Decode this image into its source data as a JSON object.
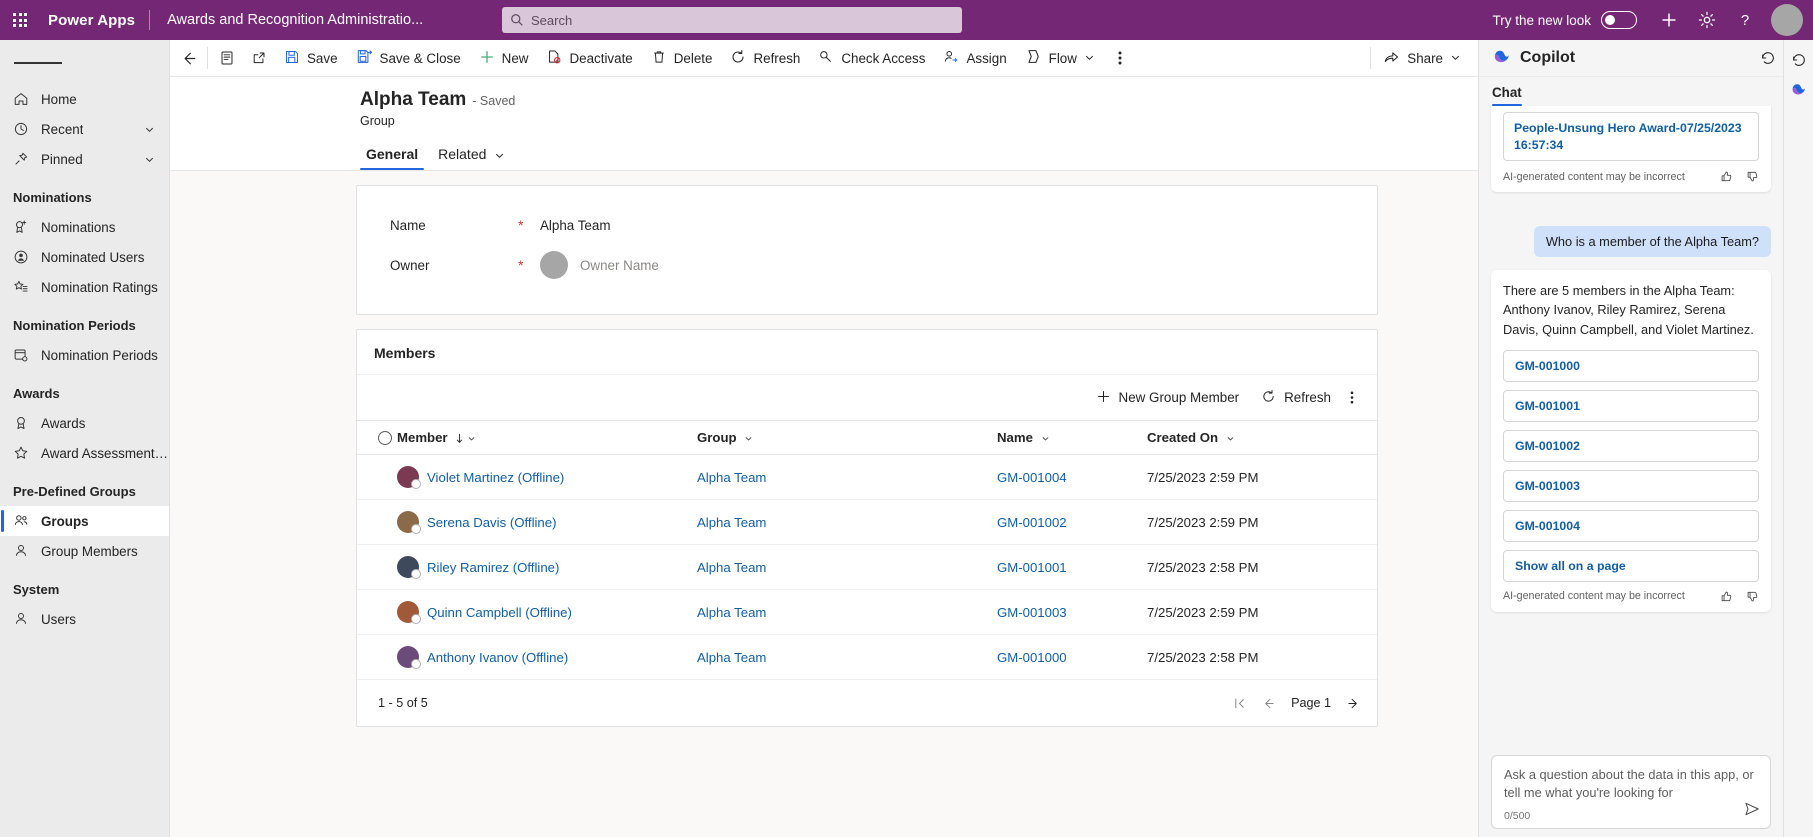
{
  "header": {
    "waffle_label": "app-launcher",
    "brand": "Power Apps",
    "app_name": "Awards and Recognition Administratio...",
    "search_placeholder": "Search",
    "search_value": "",
    "try_new_look": "Try the new look",
    "plus_label": "New",
    "gear_label": "Settings",
    "help_label": "Help",
    "brand_color": "#742774"
  },
  "sidebar": {
    "items": [
      {
        "label": "Home",
        "icon": "home-icon",
        "chevron": false,
        "selected": false
      },
      {
        "label": "Recent",
        "icon": "clock-icon",
        "chevron": true,
        "selected": false
      },
      {
        "label": "Pinned",
        "icon": "pin-icon",
        "chevron": true,
        "selected": false
      }
    ],
    "groups": [
      {
        "title": "Nominations",
        "items": [
          {
            "label": "Nominations",
            "icon": "ribbon-plus-icon",
            "selected": false
          },
          {
            "label": "Nominated Users",
            "icon": "user-badge-icon",
            "selected": false
          },
          {
            "label": "Nomination Ratings",
            "icon": "star-list-icon",
            "selected": false
          }
        ]
      },
      {
        "title": "Nomination Periods",
        "items": [
          {
            "label": "Nomination Periods",
            "icon": "calendar-gear-icon",
            "selected": false
          }
        ]
      },
      {
        "title": "Awards",
        "items": [
          {
            "label": "Awards",
            "icon": "award-icon",
            "selected": false
          },
          {
            "label": "Award Assessment R...",
            "icon": "star-icon",
            "selected": false
          }
        ]
      },
      {
        "title": "Pre-Defined Groups",
        "items": [
          {
            "label": "Groups",
            "icon": "people-icon",
            "selected": true
          },
          {
            "label": "Group Members",
            "icon": "person-icon",
            "selected": false
          }
        ]
      },
      {
        "title": "System",
        "items": [
          {
            "label": "Users",
            "icon": "person-icon",
            "selected": false
          }
        ]
      }
    ]
  },
  "commandbar": {
    "back_label": "Back",
    "form_label": "Form selector",
    "popout_label": "Open in new window",
    "commands": [
      {
        "label": "Save",
        "icon": "save-icon"
      },
      {
        "label": "Save & Close",
        "icon": "save-close-icon"
      },
      {
        "label": "New",
        "icon": "plus-icon"
      },
      {
        "label": "Deactivate",
        "icon": "deactivate-icon"
      },
      {
        "label": "Delete",
        "icon": "trash-icon"
      },
      {
        "label": "Refresh",
        "icon": "refresh-icon"
      },
      {
        "label": "Check Access",
        "icon": "key-icon"
      },
      {
        "label": "Assign",
        "icon": "assign-icon"
      },
      {
        "label": "Flow",
        "icon": "flow-icon",
        "chevron": true
      }
    ],
    "overflow_label": "More commands",
    "share_label": "Share"
  },
  "record": {
    "title": "Alpha Team",
    "saved_state": "- Saved",
    "entity": "Group",
    "tabs": [
      {
        "label": "General",
        "active": true,
        "chevron": false
      },
      {
        "label": "Related",
        "active": false,
        "chevron": true
      }
    ]
  },
  "form": {
    "fields": [
      {
        "label": "Name",
        "required": "*",
        "value": "Alpha Team",
        "type": "text"
      },
      {
        "label": "Owner",
        "required": "*",
        "value": "Owner Name",
        "type": "lookup-avatar"
      }
    ]
  },
  "members": {
    "section_title": "Members",
    "toolbar": [
      {
        "label": "New Group Member",
        "icon": "plus-icon"
      },
      {
        "label": "Refresh",
        "icon": "refresh-icon"
      }
    ],
    "overflow_label": "More",
    "columns": [
      {
        "label": "Member",
        "sorted": true,
        "chevron": true
      },
      {
        "label": "Group",
        "sorted": false,
        "chevron": true
      },
      {
        "label": "Name",
        "sorted": false,
        "chevron": true
      },
      {
        "label": "Created On",
        "sorted": false,
        "chevron": true
      }
    ],
    "rows": [
      {
        "member": "Violet Martinez (Offline)",
        "group": "Alpha Team",
        "name": "GM-001004",
        "created_on": "7/25/2023 2:59 PM",
        "avatar_color": "#7a3b52"
      },
      {
        "member": "Serena Davis (Offline)",
        "group": "Alpha Team",
        "name": "GM-001002",
        "created_on": "7/25/2023 2:59 PM",
        "avatar_color": "#8a6a48"
      },
      {
        "member": "Riley Ramirez (Offline)",
        "group": "Alpha Team",
        "name": "GM-001001",
        "created_on": "7/25/2023 2:58 PM",
        "avatar_color": "#3e4a5c"
      },
      {
        "member": "Quinn Campbell (Offline)",
        "group": "Alpha Team",
        "name": "GM-001003",
        "created_on": "7/25/2023 2:59 PM",
        "avatar_color": "#a05a3a"
      },
      {
        "member": "Anthony Ivanov (Offline)",
        "group": "Alpha Team",
        "name": "GM-001000",
        "created_on": "7/25/2023 2:58 PM",
        "avatar_color": "#6b4b7a"
      }
    ],
    "footer_count": "1 - 5 of 5",
    "page_label": "Page 1"
  },
  "copilot": {
    "title": "Copilot",
    "history_label": "Chat history",
    "expand_label": "Expand",
    "tab": "Chat",
    "prev_answer": {
      "chip": "People-Unsung Hero Award-07/25/2023 16:57:34",
      "disclaimer": "AI-generated content may be incorrect"
    },
    "user_message": "Who is a member of the Alpha Team?",
    "answer": {
      "text": "There are 5 members in the Alpha Team: Anthony Ivanov, Riley Ramirez, Serena Davis, Quinn Campbell, and Violet Martinez.",
      "chips": [
        "GM-001000",
        "GM-001001",
        "GM-001002",
        "GM-001003",
        "GM-001004"
      ],
      "show_all": "Show all on a page",
      "disclaimer": "AI-generated content may be incorrect"
    },
    "compose_placeholder": "Ask a question about the data in this app, or tell me what you're looking for",
    "compose_value": "",
    "char_count": "0/500",
    "send_label": "Send"
  }
}
